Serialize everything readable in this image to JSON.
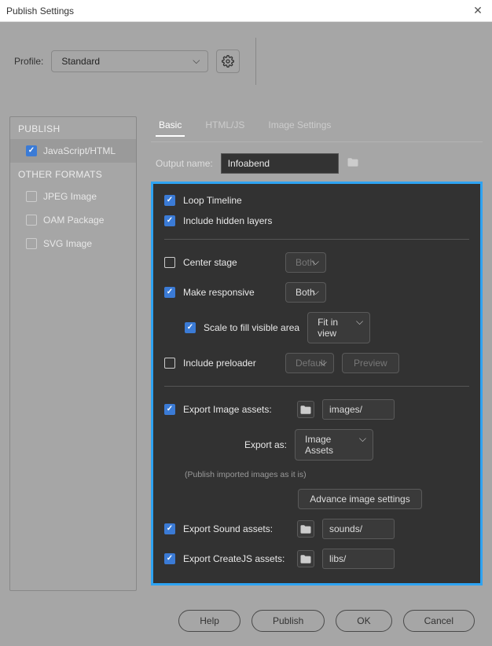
{
  "window": {
    "title": "Publish Settings"
  },
  "profile": {
    "label": "Profile:",
    "value": "Standard"
  },
  "sidebar": {
    "head1": "PUBLISH",
    "items1": [
      {
        "label": "JavaScript/HTML",
        "checked": true
      }
    ],
    "head2": "OTHER FORMATS",
    "items2": [
      {
        "label": "JPEG Image",
        "checked": false
      },
      {
        "label": "OAM Package",
        "checked": false
      },
      {
        "label": "SVG Image",
        "checked": false
      }
    ]
  },
  "tabs": {
    "basic": "Basic",
    "htmljs": "HTML/JS",
    "imgset": "Image Settings"
  },
  "output": {
    "label": "Output name:",
    "value": "Infoabend"
  },
  "opts": {
    "loop": "Loop Timeline",
    "hidden": "Include hidden layers",
    "center": "Center stage",
    "center_dd": "Both",
    "responsive": "Make responsive",
    "responsive_dd": "Both",
    "scale": "Scale to fill visible area",
    "scale_dd": "Fit in view",
    "preloader": "Include preloader",
    "preloader_dd": "Default",
    "preview_btn": "Preview",
    "exp_img": "Export Image assets:",
    "exp_img_path": "images/",
    "exp_as_lbl": "Export as:",
    "exp_as_dd": "Image Assets",
    "hint": "(Publish imported images as it is)",
    "adv_btn": "Advance image settings",
    "exp_snd": "Export Sound assets:",
    "exp_snd_path": "sounds/",
    "exp_cjs": "Export CreateJS assets:",
    "exp_cjs_path": "libs/"
  },
  "footer": {
    "help": "Help",
    "publish": "Publish",
    "ok": "OK",
    "cancel": "Cancel"
  }
}
